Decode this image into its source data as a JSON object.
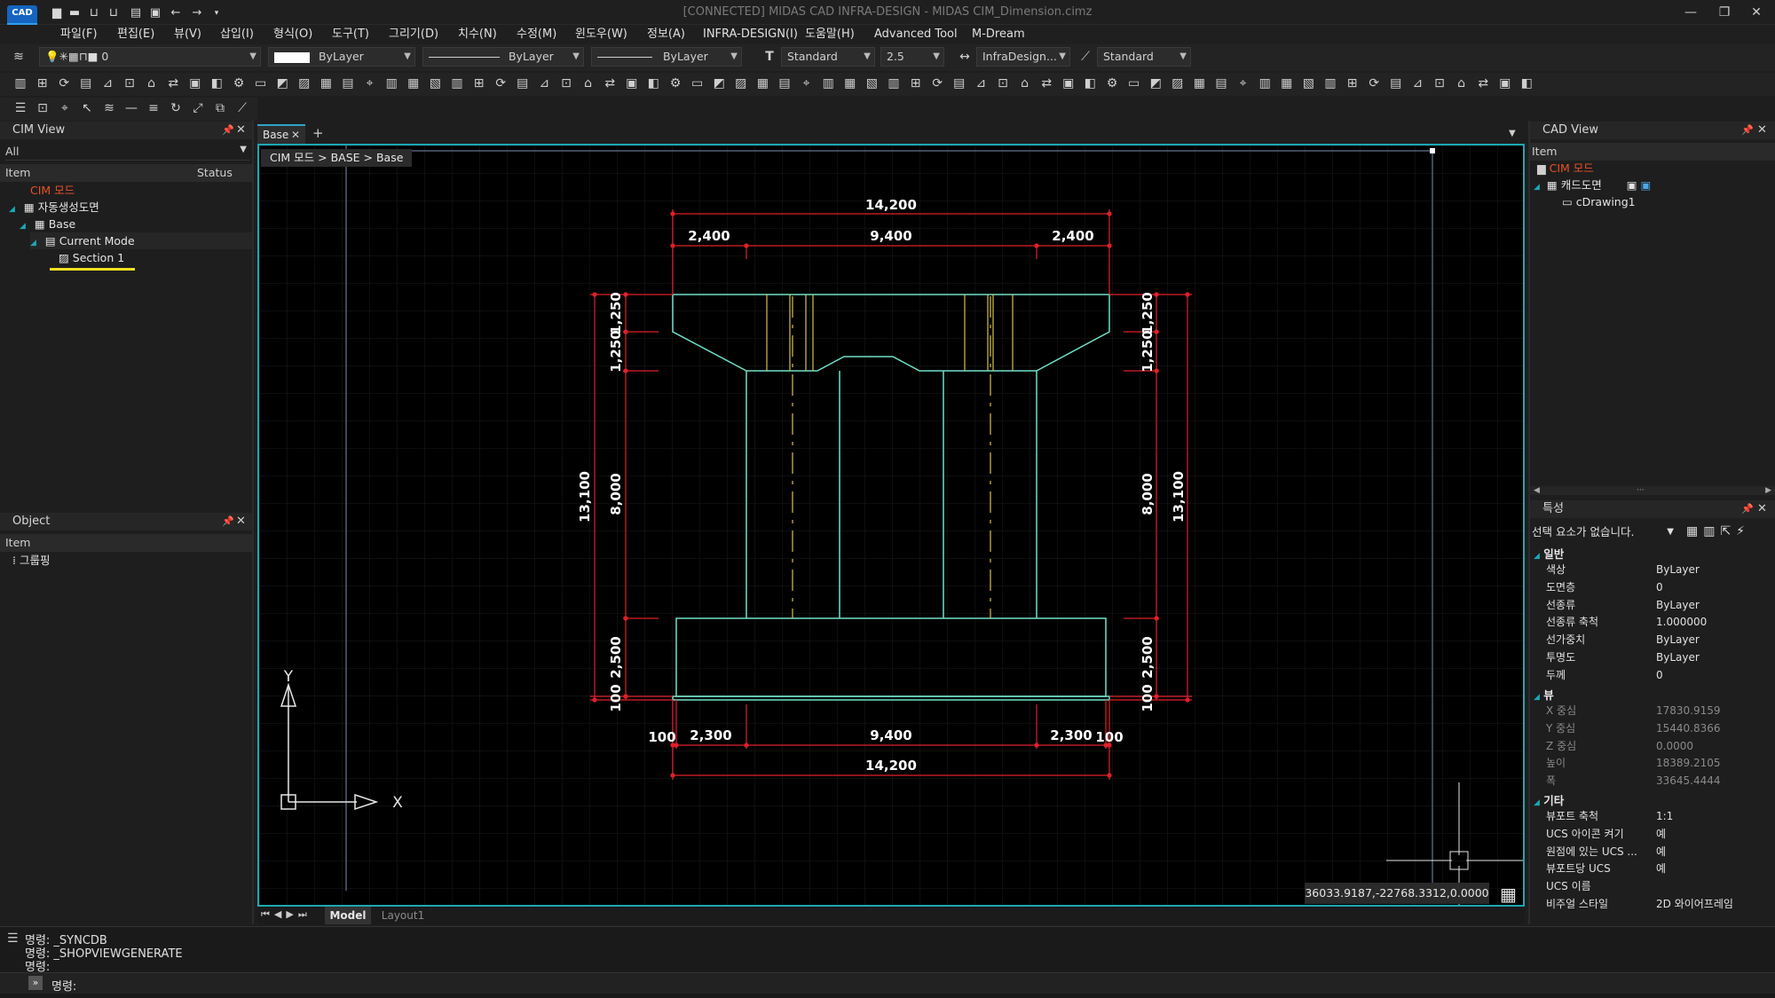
{
  "window": {
    "title": "[CONNECTED] MIDAS CAD INFRA-DESIGN - MIDAS CIM_Dimension.cimz",
    "logo": "CAD"
  },
  "menu": [
    "파일(F)",
    "편집(E)",
    "뷰(V)",
    "삽입(I)",
    "형식(O)",
    "도구(T)",
    "그리기(D)",
    "치수(N)",
    "수정(M)",
    "윈도우(W)",
    "정보(A)",
    "INFRA-DESIGN(I)",
    "도움말(H)",
    "Advanced Tool",
    "M-Dream"
  ],
  "toolbar": {
    "layer_value": "0",
    "color_value": "ByLayer",
    "linetype_value": "ByLayer",
    "lineweight_value": "ByLayer",
    "textstyle_value": "Standard",
    "textheight_value": "2.5",
    "dimstyle_value": "InfraDesign...",
    "tablestyle_value": "Standard"
  },
  "cim_view": {
    "title": "CIM View",
    "filter": "All",
    "col_item": "Item",
    "col_status": "Status",
    "tree": [
      {
        "label": "CIM 모드",
        "level": 0
      },
      {
        "label": "자동생성도면",
        "level": 0
      },
      {
        "label": "Base",
        "level": 1
      },
      {
        "label": "Current Mode",
        "level": 2
      },
      {
        "label": "Section 1",
        "level": 3
      }
    ]
  },
  "object_panel": {
    "title": "Object",
    "col_item": "Item",
    "items": [
      "그룹핑"
    ]
  },
  "document": {
    "tab_label": "Base",
    "breadcrumb": "CIM 모드 > BASE > Base",
    "coordinates": "36033.9187,-22768.3312,0.0000",
    "layout_tabs": [
      "Model",
      "Layout1"
    ]
  },
  "drawing": {
    "top_total": "14,200",
    "top_left": "2,400",
    "top_mid": "9,400",
    "top_right": "2,400",
    "left_total": "13,100",
    "left_cap1": "1,250",
    "left_cap2": "1,250",
    "left_col": "8,000",
    "left_foot": "2,500",
    "left_lean": "100",
    "right_total": "13,100",
    "right_cap1": "1,250",
    "right_cap2": "1,250",
    "right_col": "8,000",
    "right_foot": "2,500",
    "right_lean": "100",
    "bot_left_small": "100",
    "bot_left": "2,300",
    "bot_mid": "9,400",
    "bot_right": "2,300",
    "bot_right_small": "100",
    "bot_total": "14,200",
    "ucs_x": "X",
    "ucs_y": "Y"
  },
  "cad_view": {
    "title": "CAD View",
    "col_item": "Item",
    "tree": [
      {
        "label": "CIM 모드"
      },
      {
        "label": "캐드도면"
      },
      {
        "label": "cDrawing1"
      }
    ]
  },
  "properties": {
    "title": "특성",
    "selection": "선택 요소가 없습니다.",
    "categories": {
      "general": "일반",
      "view": "뷰",
      "misc": "기타"
    },
    "general": [
      {
        "key": "색상",
        "value": "ByLayer"
      },
      {
        "key": "도면층",
        "value": "0"
      },
      {
        "key": "선종류",
        "value": "ByLayer"
      },
      {
        "key": "선종류 축척",
        "value": "1.000000"
      },
      {
        "key": "선가중치",
        "value": "ByLayer"
      },
      {
        "key": "투명도",
        "value": "ByLayer"
      },
      {
        "key": "두께",
        "value": "0"
      }
    ],
    "view": [
      {
        "key": "X 중심",
        "value": "17830.9159"
      },
      {
        "key": "Y 중심",
        "value": "15440.8366"
      },
      {
        "key": "Z 중심",
        "value": "0.0000"
      },
      {
        "key": "높이",
        "value": "18389.2105"
      },
      {
        "key": "폭",
        "value": "33645.4444"
      }
    ],
    "misc": [
      {
        "key": "뷰포트 축척",
        "value": "1:1"
      },
      {
        "key": "UCS 아이콘 켜기",
        "value": "예"
      },
      {
        "key": "원점에 있는 UCS ...",
        "value": "예"
      },
      {
        "key": "뷰포트당 UCS",
        "value": "예"
      },
      {
        "key": "UCS 이름",
        "value": ""
      },
      {
        "key": "비주얼 스타일",
        "value": "2D 와이어프레임"
      }
    ]
  },
  "command": {
    "history": [
      "명령: _SYNCDB",
      "명령: _SHOPVIEWGENERATE",
      "명령:"
    ],
    "prompt": "명령:"
  },
  "colors": {
    "viewport_border": "#1ba7b4",
    "dimension": "#e0202a",
    "outline": "#6fe0c8",
    "centerline": "#d8c24a",
    "tree_red": "#e8502a"
  }
}
